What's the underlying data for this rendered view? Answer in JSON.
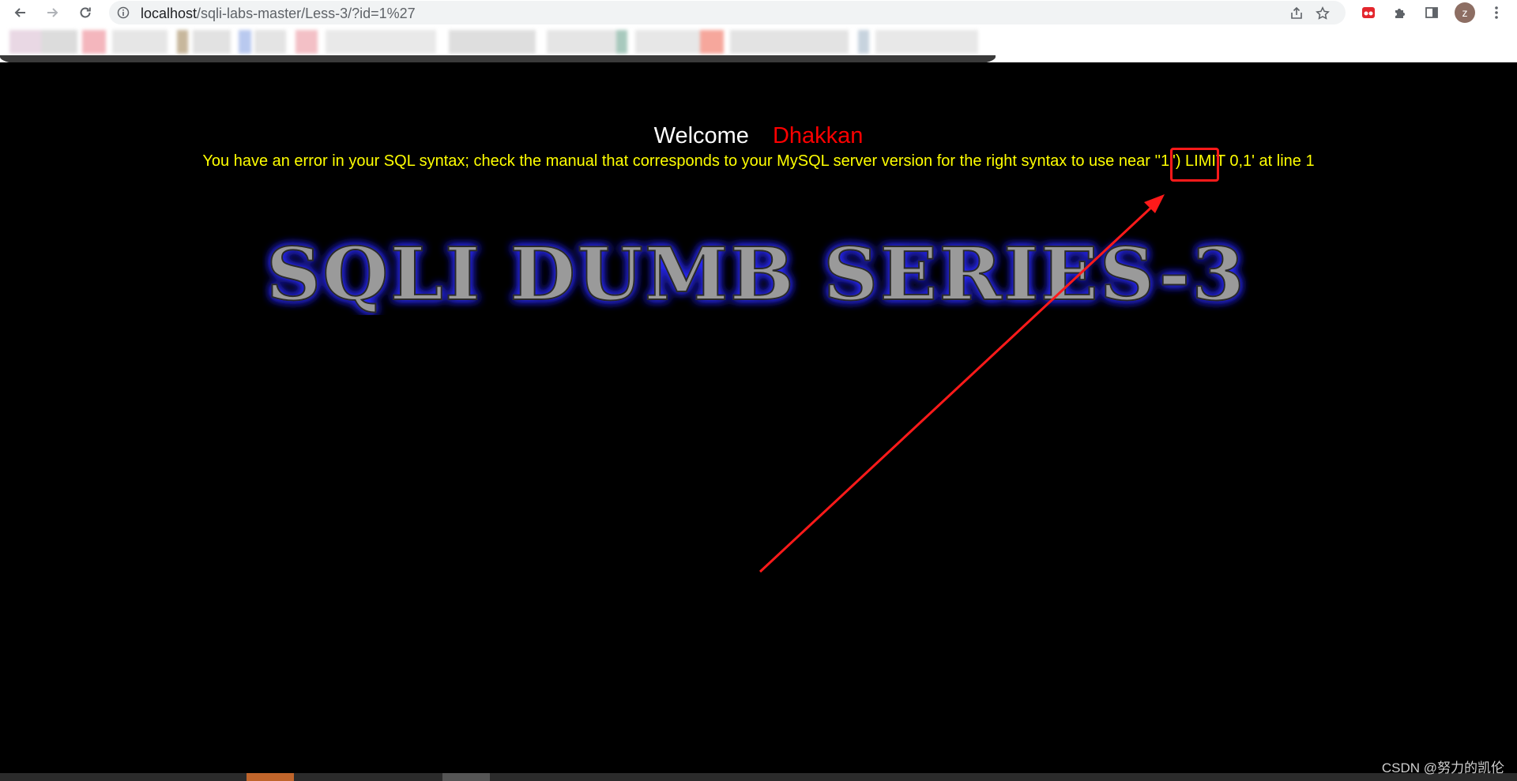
{
  "browser": {
    "url_host": "localhost",
    "url_path": "/sqli-labs-master/Less-3/?id=1%27",
    "avatar_letter": "z",
    "icons": {
      "back": "arrow-left-icon",
      "forward": "arrow-right-icon",
      "reload": "reload-icon",
      "site_info": "info-icon",
      "share": "share-icon",
      "bookmark": "star-icon",
      "extension_red": "extension-icon",
      "extensions": "puzzle-icon",
      "side_panel": "side-panel-icon",
      "menu": "kebab-menu-icon"
    }
  },
  "page": {
    "welcome": "Welcome",
    "username": "Dhakkan",
    "sql_error": "You have an error in your SQL syntax; check the manual that corresponds to your MySQL server version for the right syntax to use near ''1'') LIMIT 0,1' at line 1",
    "banner_title": "SQLI DUMB SERIES-3"
  },
  "annotation": {
    "color": "#ff1a1a"
  },
  "watermark": "CSDN @努力的凯伦",
  "colors": {
    "background": "#000000",
    "welcome": "#ffffff",
    "username": "#ff0000",
    "error_text": "#ffff00"
  }
}
